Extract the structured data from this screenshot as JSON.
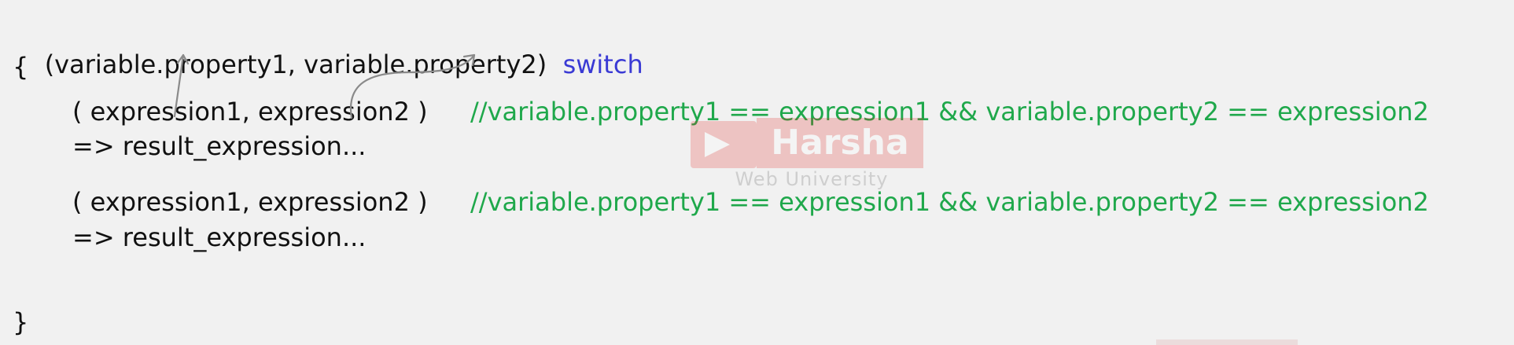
{
  "code": {
    "header": "(variable.property1, variable.property2)",
    "keyword": "switch",
    "open_brace": "{",
    "close_brace": "}",
    "cases": [
      {
        "pattern": "( expression1, expression2 )",
        "comment": "//variable.property1 == expression1 && variable.property2 == expression2",
        "result": "=> result_expression..."
      },
      {
        "pattern": "( expression1, expression2 )",
        "comment": "//variable.property1 == expression1 && variable.property2 == expression2",
        "result": "=> result_expression..."
      }
    ]
  },
  "watermark": {
    "brand": "Harsha",
    "sub": "Web University"
  },
  "colors": {
    "keyword": "#3a3ad4",
    "comment": "#1fa84b",
    "text": "#111111",
    "arrow": "#8a8a8a",
    "background": "#f1f1f1"
  }
}
